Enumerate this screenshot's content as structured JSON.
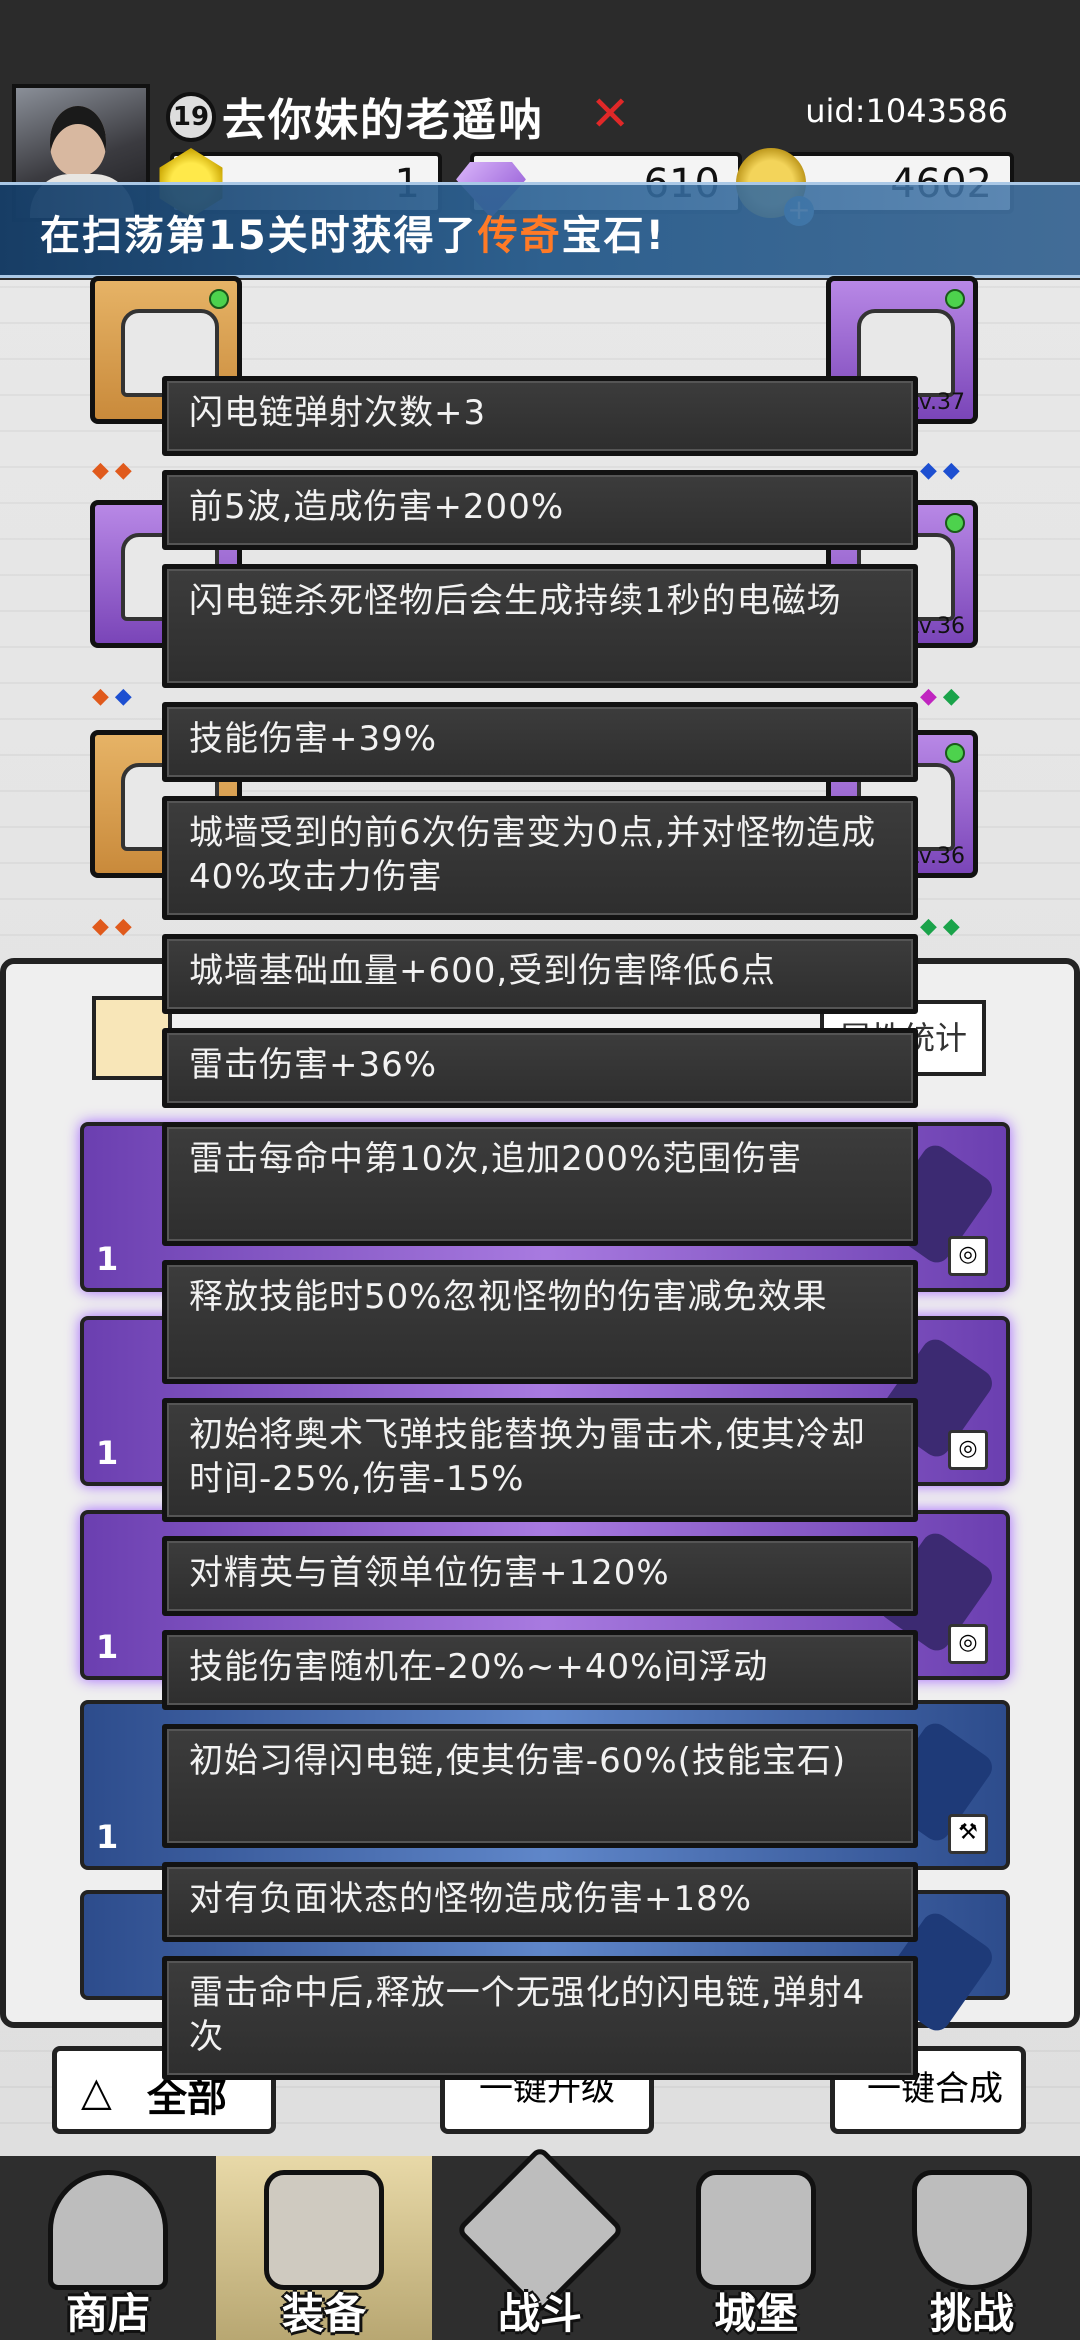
{
  "player": {
    "level": "19",
    "name": "去你妹的老遥呐",
    "uid": "uid:1043586"
  },
  "currencies": {
    "gold": "1",
    "gem": "610",
    "coin": "4602"
  },
  "banner": {
    "prefix": "在扫荡第15关时获得了",
    "highlight": "传奇",
    "suffix": "宝石!"
  },
  "equipment": {
    "right_levels": [
      "Lv.37",
      "Lv.36",
      "Lv.36"
    ]
  },
  "inventory": {
    "attr_button_label": "属性统计",
    "card_counts": [
      "1",
      "1",
      "1",
      "1"
    ]
  },
  "actions": {
    "all_label": "全部",
    "upgrade_label": "一键升级",
    "merge_label": "一键合成"
  },
  "nav": [
    {
      "label": "商店"
    },
    {
      "label": "装备"
    },
    {
      "label": "战斗"
    },
    {
      "label": "城堡"
    },
    {
      "label": "挑战"
    }
  ],
  "affixes": [
    "闪电链弹射次数+3",
    "前5波,造成伤害+200%",
    "闪电链杀死怪物后会生成持续1秒的电磁场",
    "技能伤害+39%",
    "城墙受到的前6次伤害变为0点,并对怪物造成40%攻击力伤害",
    "城墙基础血量+600,受到伤害降低6点",
    "雷击伤害+36%",
    "雷击每命中第10次,追加200%范围伤害",
    "释放技能时50%忽视怪物的伤害减免效果",
    "初始将奥术飞弹技能替换为雷击术,使其冷却时间-25%,伤害-15%",
    "对精英与首领单位伤害+120%",
    "技能伤害随机在-20%~+40%间浮动",
    "初始习得闪电链,使其伤害-60%(技能宝石)",
    "对有负面状态的怪物造成伤害+18%",
    "雷击命中后,释放一个无强化的闪电链,弹射4次"
  ],
  "colors": {
    "banner_highlight": "#ff7a26",
    "tooltip_bg": "#353535",
    "rarity_purple": "#8a55d0",
    "rarity_gold": "#d9a04f"
  }
}
